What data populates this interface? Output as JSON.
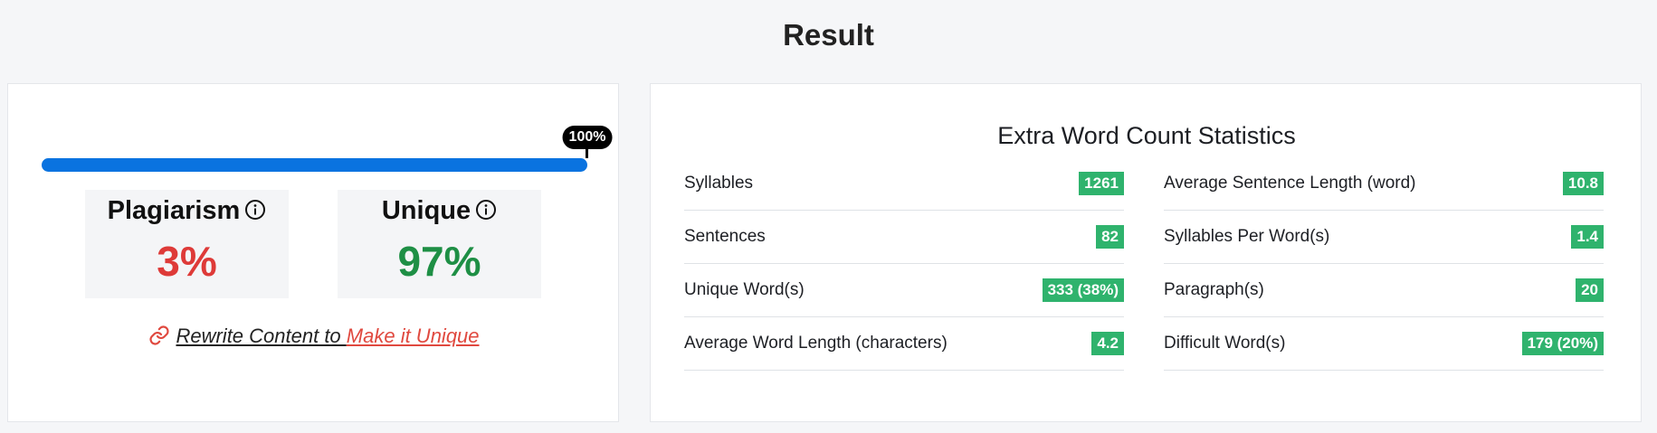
{
  "page": {
    "title": "Result"
  },
  "plagiarism_panel": {
    "progress": {
      "label": "100%",
      "percent": 100,
      "fill_color": "#0a73e0"
    },
    "plagiarism": {
      "label": "Plagiarism",
      "value": "3%",
      "color": "#de3a38"
    },
    "unique": {
      "label": "Unique",
      "value": "97%",
      "color": "#1e8f45"
    },
    "rewrite": {
      "text": "Rewrite Content to ",
      "link": "Make it Unique"
    }
  },
  "stats_panel": {
    "title": "Extra Word Count Statistics",
    "badge_color": "#2fb36d",
    "left": [
      {
        "label": "Syllables",
        "value": "1261"
      },
      {
        "label": "Sentences",
        "value": "82"
      },
      {
        "label": "Unique Word(s)",
        "value": "333 (38%)"
      },
      {
        "label": "Average Word Length (characters)",
        "value": "4.2"
      }
    ],
    "right": [
      {
        "label": "Average Sentence Length (word)",
        "value": "10.8"
      },
      {
        "label": "Syllables Per Word(s)",
        "value": "1.4"
      },
      {
        "label": "Paragraph(s)",
        "value": "20"
      },
      {
        "label": "Difficult Word(s)",
        "value": "179 (20%)"
      }
    ]
  }
}
